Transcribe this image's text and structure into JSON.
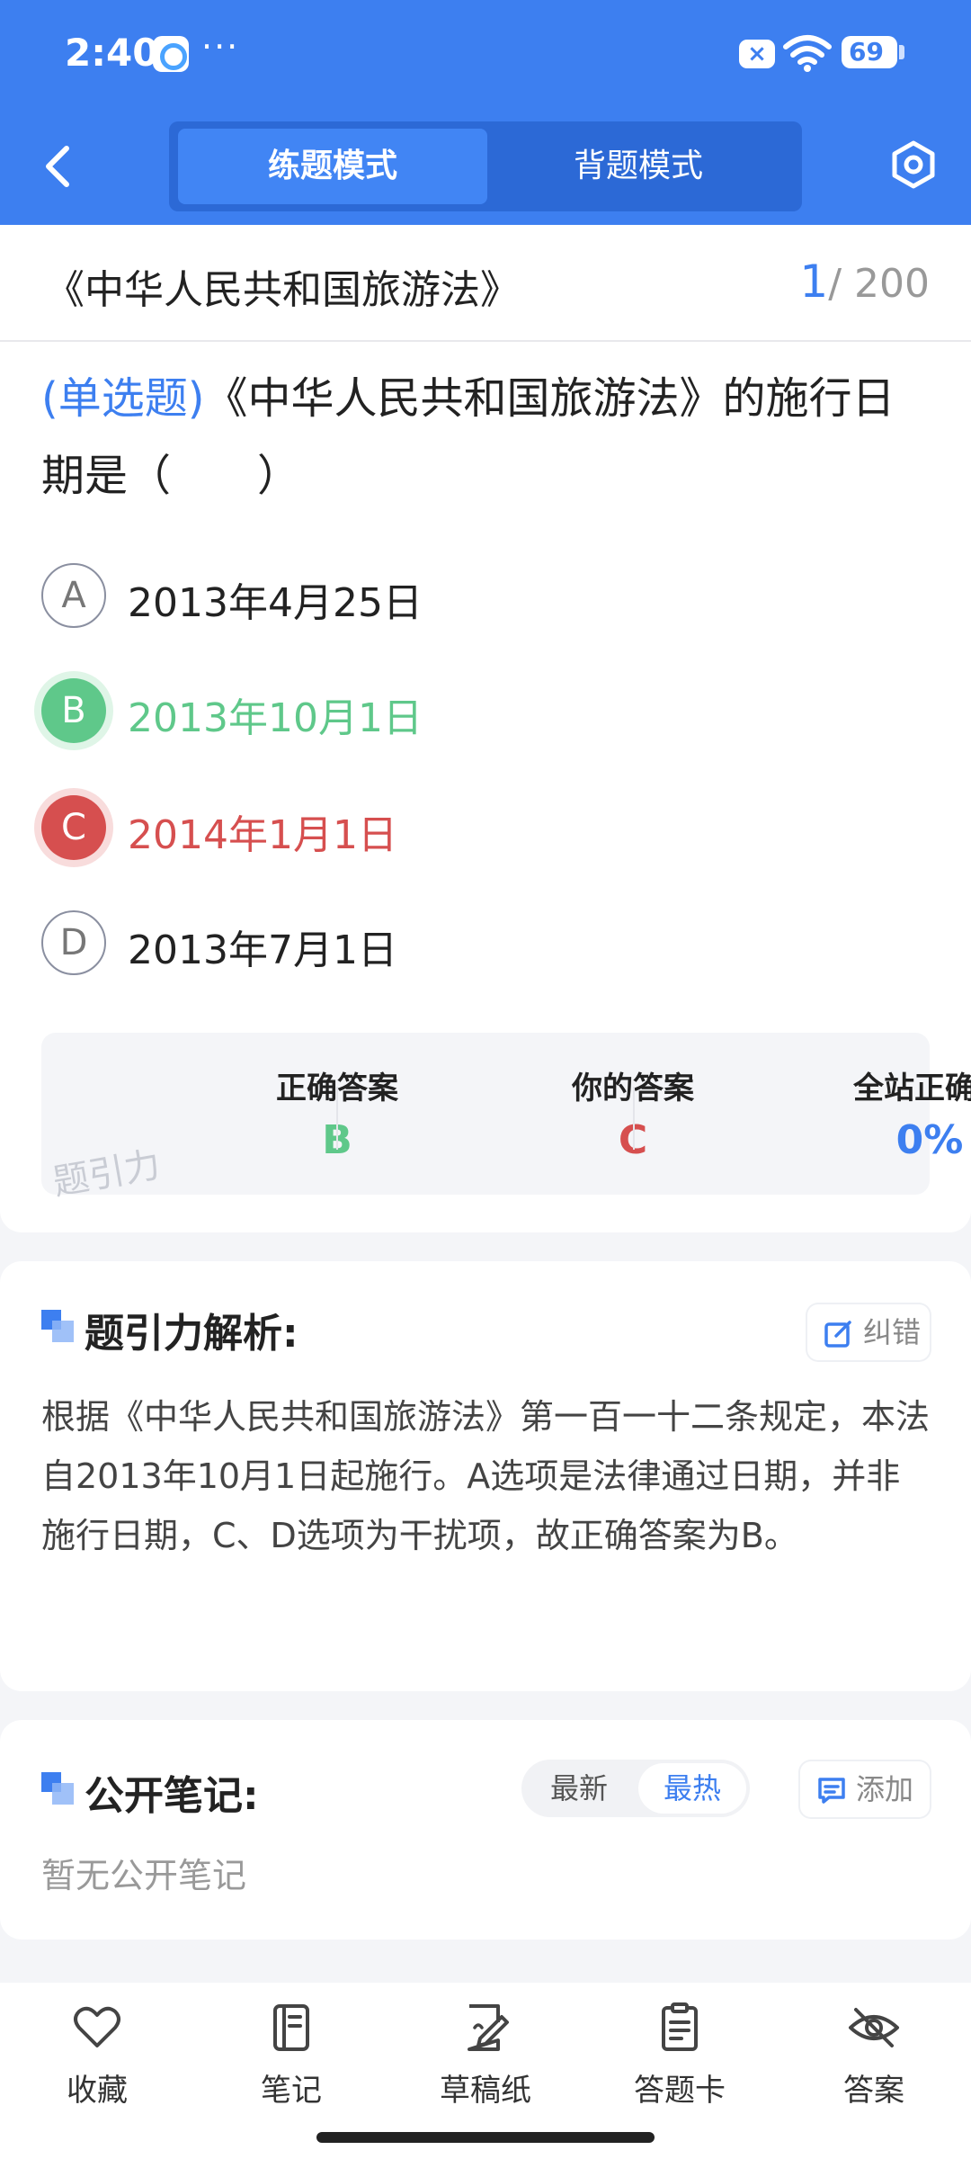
{
  "status_bar": {
    "time": "2:40",
    "more": "···",
    "battery": "69"
  },
  "header": {
    "modes": [
      "练题模式",
      "背题模式"
    ],
    "active_mode": "练题模式"
  },
  "title_row": {
    "book_title": "《中华人民共和国旅游法》",
    "current": "1",
    "total": "/ 200"
  },
  "question": {
    "type": "(单选题)",
    "stem": "《中华人民共和国旅游法》的施行日期是（　　）",
    "options": [
      {
        "letter": "A",
        "text": "2013年4月25日",
        "state": "normal"
      },
      {
        "letter": "B",
        "text": "2013年10月1日",
        "state": "correct"
      },
      {
        "letter": "C",
        "text": "2014年1月1日",
        "state": "wrong"
      },
      {
        "letter": "D",
        "text": "2013年7月1日",
        "state": "normal"
      }
    ]
  },
  "answer_summary": {
    "correct_label": "正确答案",
    "correct_value": "B",
    "yours_label": "你的答案",
    "yours_value": "C",
    "rate_label": "全站正确率",
    "rate_value": "0%",
    "watermark": "题引力"
  },
  "analysis": {
    "title": "题引力解析:",
    "report_label": "纠错",
    "text": "根据《中华人民共和国旅游法》第一百一十二条规定，本法自2013年10月1日起施行。A选项是法律通过日期，并非施行日期，C、D选项为干扰项，故正确答案为B。"
  },
  "notes": {
    "title": "公开笔记:",
    "sort_options": [
      "最新",
      "最热"
    ],
    "active_sort": "最热",
    "add_label": "添加",
    "empty_text": "暂无公开笔记"
  },
  "bottom_tabs": [
    {
      "label": "收藏",
      "icon": "heart-icon"
    },
    {
      "label": "笔记",
      "icon": "notebook-icon"
    },
    {
      "label": "草稿纸",
      "icon": "draft-paper-icon"
    },
    {
      "label": "答题卡",
      "icon": "answer-card-icon"
    },
    {
      "label": "答案",
      "icon": "eye-off-icon"
    }
  ],
  "colors": {
    "primary": "#3d7ff0",
    "correct": "#5fc88a",
    "wrong": "#d64f4f"
  }
}
